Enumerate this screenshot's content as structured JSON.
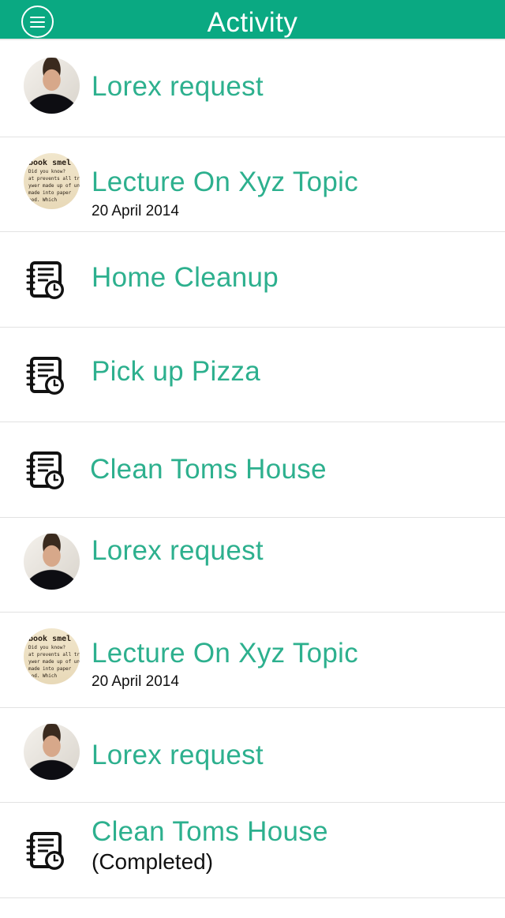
{
  "header": {
    "title": "Activity",
    "menu_icon": "hamburger-menu-icon",
    "background_color": "#0aa982"
  },
  "accent_color": "#2db08e",
  "items": [
    {
      "title": "Lorex request",
      "icon": "person-avatar"
    },
    {
      "title": "Lecture On Xyz Topic",
      "date": "20 April 2014",
      "icon": "book-avatar"
    },
    {
      "title": "Home Cleanup",
      "icon": "task-notepad-clock-icon"
    },
    {
      "title": "Pick up Pizza",
      "icon": "task-notepad-clock-icon"
    },
    {
      "title": "Clean Toms House",
      "icon": "task-notepad-clock-icon"
    },
    {
      "title": "Lorex request",
      "icon": "person-avatar"
    },
    {
      "title": "Lecture On Xyz Topic",
      "date": "20 April 2014",
      "icon": "book-avatar"
    },
    {
      "title": "Lorex request",
      "icon": "person-avatar"
    },
    {
      "title": "Clean Toms House",
      "status": "(Completed)",
      "icon": "task-notepad-clock-icon"
    }
  ],
  "book_avatar_text": {
    "line1": "book smel",
    "line2": "Did you know?",
    "line3": "at prevents all tree",
    "line4": "ywer made up of un",
    "line5": "made into paper",
    "line6": "ood. Which"
  }
}
